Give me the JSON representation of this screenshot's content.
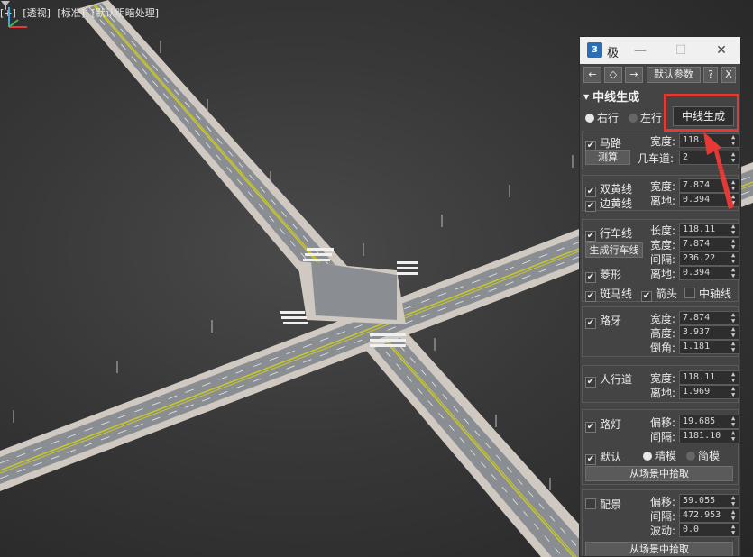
{
  "viewport": {
    "labels": [
      "[+]",
      "[透视]",
      "[标准]",
      "[默认明暗处理]"
    ],
    "filter_icon": "funnel-icon"
  },
  "panel": {
    "title": "极",
    "app_icon": "3",
    "toolbar": {
      "back": "←",
      "diamond": "◇",
      "forward": "→",
      "defaults": "默认参数",
      "help": "?",
      "close": "X"
    },
    "section_title": "中线生成",
    "direction": {
      "right": "右行",
      "left": "左行",
      "selected": "right"
    },
    "generate_btn": "中线生成",
    "road": {
      "label": "马路",
      "width_label": "宽度:",
      "width": "118.1",
      "measure_btn": "测算",
      "lanes_label": "几车道:",
      "lanes": "2"
    },
    "yellow": {
      "double_label": "双黄线",
      "edge_label": "边黄线",
      "width_label": "宽度:",
      "width": "7.874",
      "offset_label": "离地:",
      "offset": "0.394"
    },
    "lane": {
      "label": "行车线",
      "gen_btn": "生成行车线",
      "length_label": "长度:",
      "length": "118.11",
      "width_label": "宽度:",
      "width": "7.874",
      "gap_label": "间隔:",
      "gap": "236.22",
      "offset_label": "离地:",
      "offset": "0.394",
      "diamond_label": "菱形",
      "zebra_label": "斑马线",
      "arrow_label": "箭头",
      "axis_label": "中轴线"
    },
    "curb": {
      "label": "路牙",
      "width_label": "宽度:",
      "width": "7.874",
      "height_label": "高度:",
      "height": "3.937",
      "chamfer_label": "倒角:",
      "chamfer": "1.181"
    },
    "sidewalk": {
      "label": "人行道",
      "width_label": "宽度:",
      "width": "118.11",
      "offset_label": "离地:",
      "offset": "1.969"
    },
    "streetlight": {
      "label": "路灯",
      "offset_label": "偏移:",
      "offset": "19.685",
      "gap_label": "间隔:",
      "gap": "1181.10",
      "default_label": "默认",
      "fine_label": "精模",
      "simple_label": "简模",
      "pick_btn": "从场景中拾取"
    },
    "scenery": {
      "label": "配景",
      "offset_label": "偏移:",
      "offset": "59.055",
      "gap_label": "间隔:",
      "gap": "472.953",
      "jitter_label": "波动:",
      "jitter": "0.0",
      "pick_btn": "从场景中拾取"
    }
  },
  "colors": {
    "highlight": "#e53935",
    "road": "#8a8e92",
    "sidewalk": "#cfc9c2",
    "lane_yellow": "#c8c82a"
  }
}
